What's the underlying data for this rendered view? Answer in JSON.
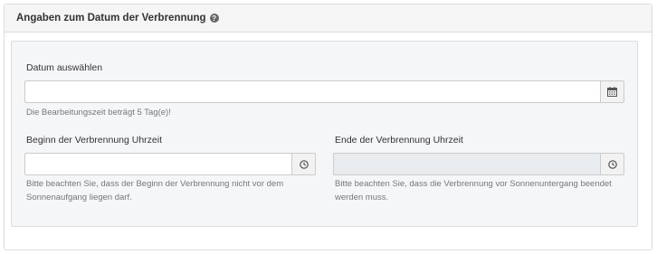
{
  "panel": {
    "title": "Angaben zum Datum der Verbrennung",
    "help_icon": "question-circle-icon",
    "help_glyph": "?"
  },
  "date": {
    "label": "Datum auswählen",
    "value": "",
    "icon": "calendar-icon",
    "help": "Die Bearbeitungszeit beträgt 5 Tag(e)!"
  },
  "start_time": {
    "label": "Beginn der Verbrennung Uhrzeit",
    "value": "",
    "icon": "clock-icon",
    "help": "Bitte beachten Sie, dass der Beginn der Verbrennung nicht vor dem Sonnenaufgang liegen darf."
  },
  "end_time": {
    "label": "Ende der Verbrennung Uhrzeit",
    "value": "",
    "disabled": true,
    "icon": "clock-icon",
    "help": "Bitte beachten Sie, dass die Verbrennung vor Sonnenuntergang beendet werden muss."
  }
}
